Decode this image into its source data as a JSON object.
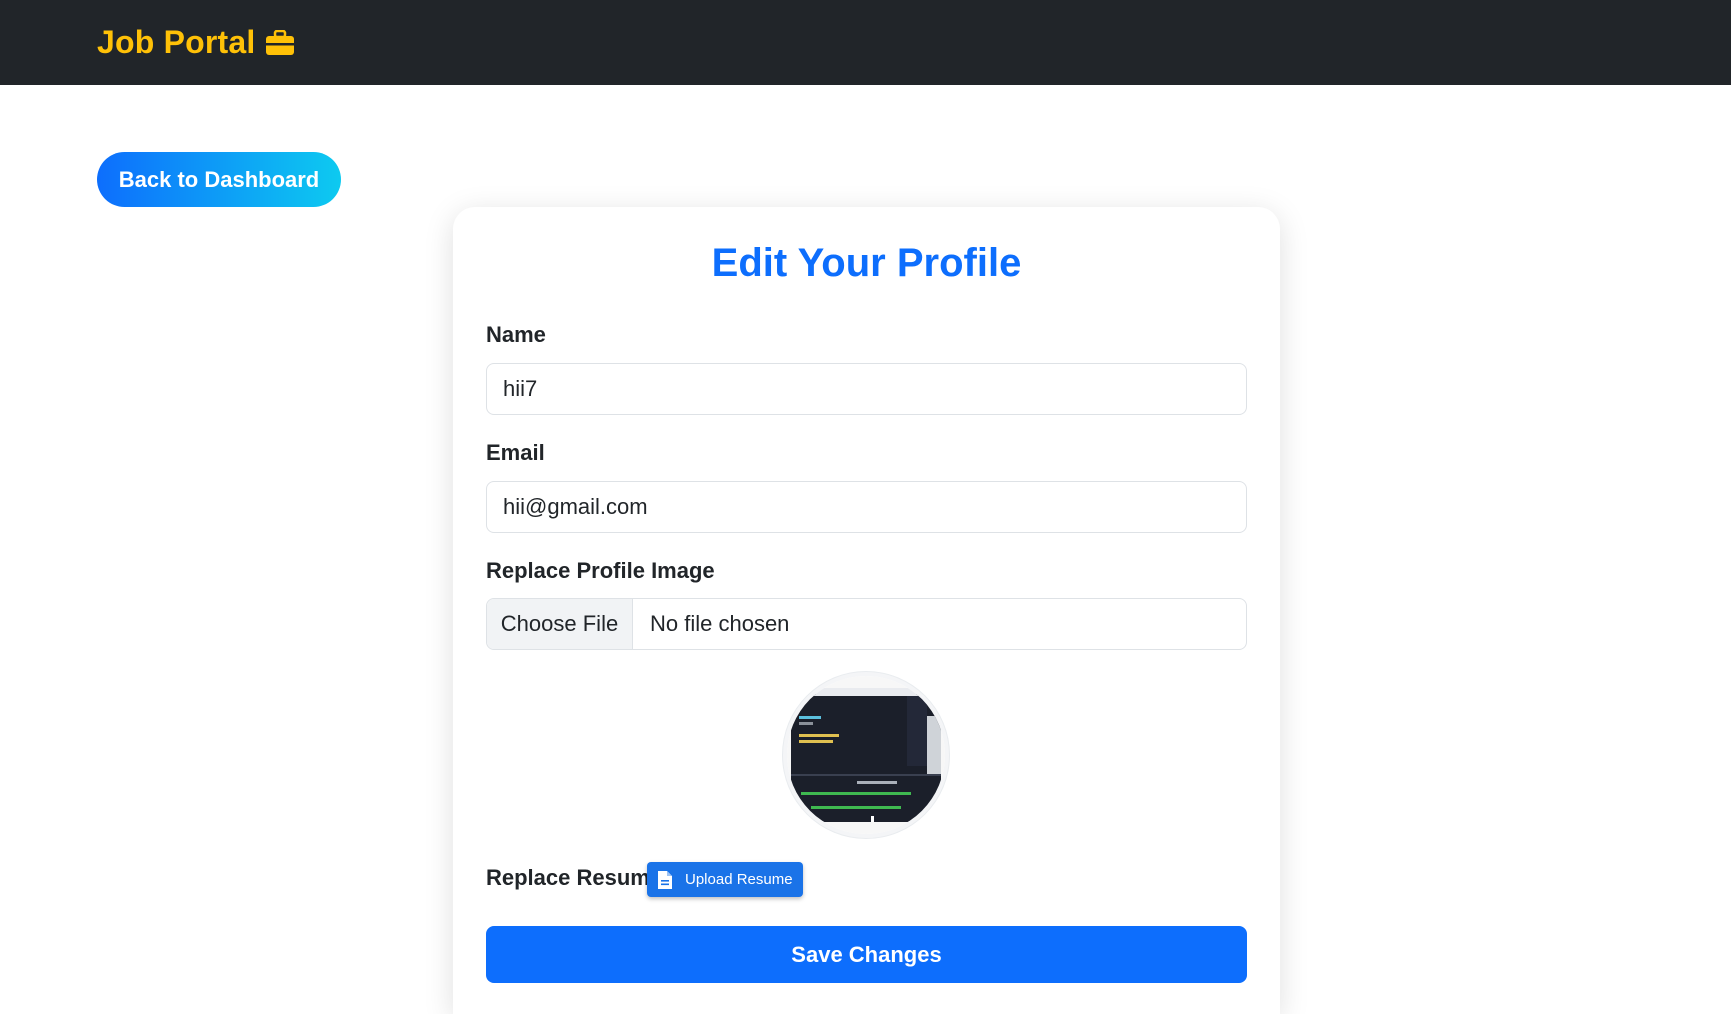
{
  "navbar": {
    "brand_label": "Job Portal",
    "brand_icon": "briefcase-icon",
    "brand_color": "#ffc107",
    "background": "#212529"
  },
  "back_button": {
    "label": "Back to Dashboard"
  },
  "form": {
    "title": "Edit Your Profile",
    "name": {
      "label": "Name",
      "value": "hii7"
    },
    "email": {
      "label": "Email",
      "value": "hii@gmail.com"
    },
    "profile_image": {
      "label": "Replace Profile Image",
      "button_label": "Choose File",
      "status_text": "No file chosen"
    },
    "resume": {
      "label": "Replace Resume",
      "button_label": "Upload Resume",
      "button_icon": "document-icon"
    },
    "save_label": "Save Changes"
  },
  "colors": {
    "primary": "#0d6efd",
    "accent_cyan": "#0dcaf0",
    "upload_button": "#1a73e8"
  }
}
